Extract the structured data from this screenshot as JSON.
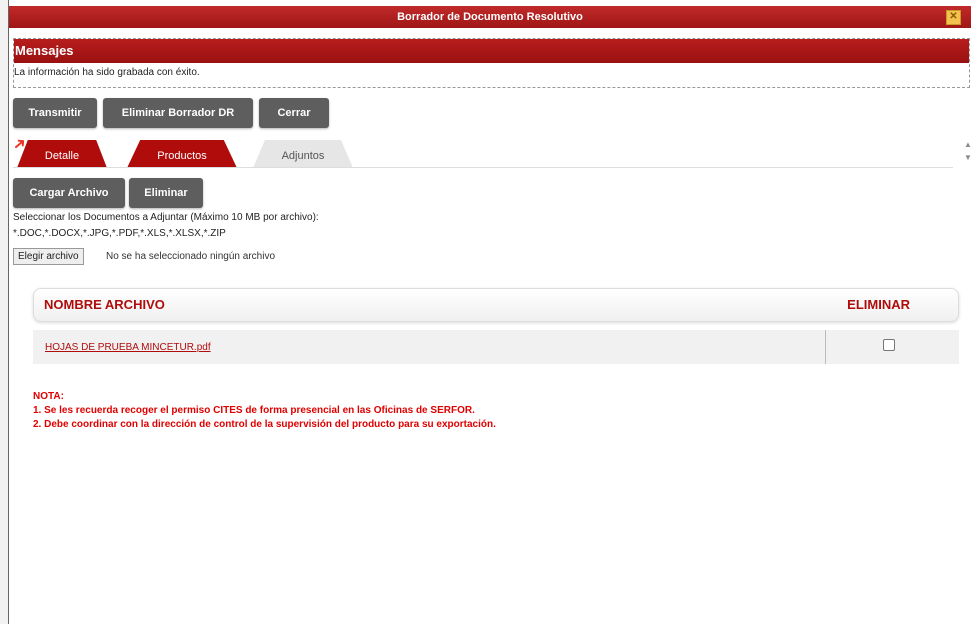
{
  "window": {
    "title": "Borrador de Documento Resolutivo",
    "close_icon": "close-icon"
  },
  "messages": {
    "header": "Mensajes",
    "text": "La información ha sido grabada con éxito."
  },
  "actions": {
    "transmit_label": "Transmitir",
    "delete_draft_label": "Eliminar Borrador DR",
    "close_label": "Cerrar"
  },
  "tabs": [
    {
      "label": "Detalle"
    },
    {
      "label": "Productos"
    },
    {
      "label": "Adjuntos"
    }
  ],
  "attachments": {
    "upload_label": "Cargar Archivo",
    "delete_label": "Eliminar",
    "instruction": "Seleccionar los Documentos a Adjuntar (Máximo 10 MB por archivo):",
    "allowed_types": "*.DOC,*.DOCX,*.JPG,*.PDF,*.XLS,*.XLSX,*.ZIP",
    "choose_file_label": "Elegir archivo",
    "no_file_selected": "No se ha seleccionado ningún archivo",
    "table": {
      "headers": [
        "NOMBRE ARCHIVO",
        "ELIMINAR"
      ],
      "rows": [
        {
          "file_name": "HOJAS DE PRUEBA MINCETUR.pdf",
          "delete_checked": false
        }
      ]
    }
  },
  "notes": {
    "title": "NOTA:",
    "lines": [
      "1. Se les recuerda recoger el permiso CITES de forma presencial en las Oficinas de SERFOR.",
      "2. Debe coordinar con la dirección de control de la supervisión del producto para su exportación."
    ]
  },
  "colors": {
    "accent": "#b00c0c",
    "button": "#5e5e5e",
    "note": "#e00000"
  }
}
